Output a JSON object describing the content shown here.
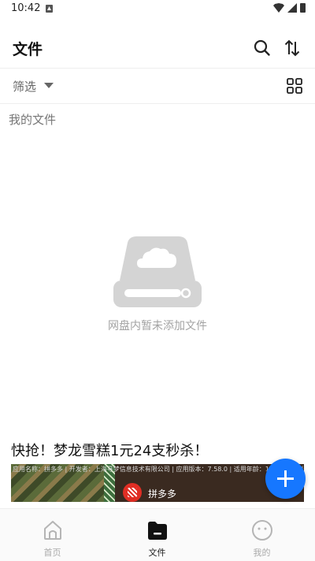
{
  "status_bar": {
    "time": "10:42"
  },
  "header": {
    "title": "文件"
  },
  "filter": {
    "label": "筛选"
  },
  "breadcrumb": {
    "label": "我的文件"
  },
  "empty_state": {
    "message": "网盘内暂未添加文件"
  },
  "promo": {
    "title": "快抢！梦龙雪糕1元24支秒杀！",
    "ad_info": "应用名称：拼多多 | 开发者：上海寻梦信息技术有限公司 | 应用版本：7.58.0 | 适用年龄：12+ | 权限详情",
    "brand": "拼多多"
  },
  "bottom_nav": [
    {
      "label": "首页",
      "active": false
    },
    {
      "label": "文件",
      "active": true
    },
    {
      "label": "我的",
      "active": false
    }
  ],
  "colors": {
    "accent": "#1677ff",
    "empty_icon": "#d4d4d4",
    "brand_red": "#e02e24"
  }
}
